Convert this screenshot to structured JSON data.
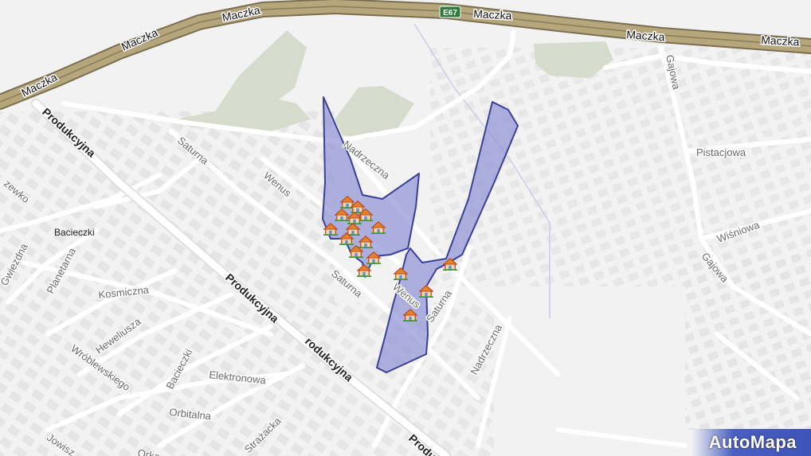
{
  "map": {
    "streets": {
      "maczka": "Maczka",
      "e67": "E67",
      "produkcyjna": "Produkcyjna",
      "produkcyjna_partial": "rodukcyjna",
      "produkcyjna_bottom": "Produ",
      "saturna": "Saturna",
      "wenus": "Wenus",
      "nadrzeczna": "Nadrzeczna",
      "gajowa": "Gajowa",
      "pistacjowa": "Pistacjowa",
      "wisniowa": "Wiśniowa",
      "kosmiczna": "Kosmiczna",
      "planetarna": "Planetarna",
      "gwiezdna": "Gwiezdna",
      "heweliusza": "Heweliusza",
      "wroblewskiego": "Wróblewskiego",
      "bacieczki_street": "Bacieczki",
      "elektronowa": "Elektronowa",
      "orbitalna": "Orbitalna",
      "strazacka": "Strażacka",
      "jowiszowa": "Jowisz",
      "orkana": "Orkan",
      "edge_left": "zewko"
    },
    "places": {
      "bacieczki": "Bacieczki"
    },
    "poi_icon": "house-icon",
    "highlight_color": "#8f93d6",
    "highlight_stroke": "#3b3f98"
  },
  "brand": {
    "name": "AutoMapa"
  }
}
